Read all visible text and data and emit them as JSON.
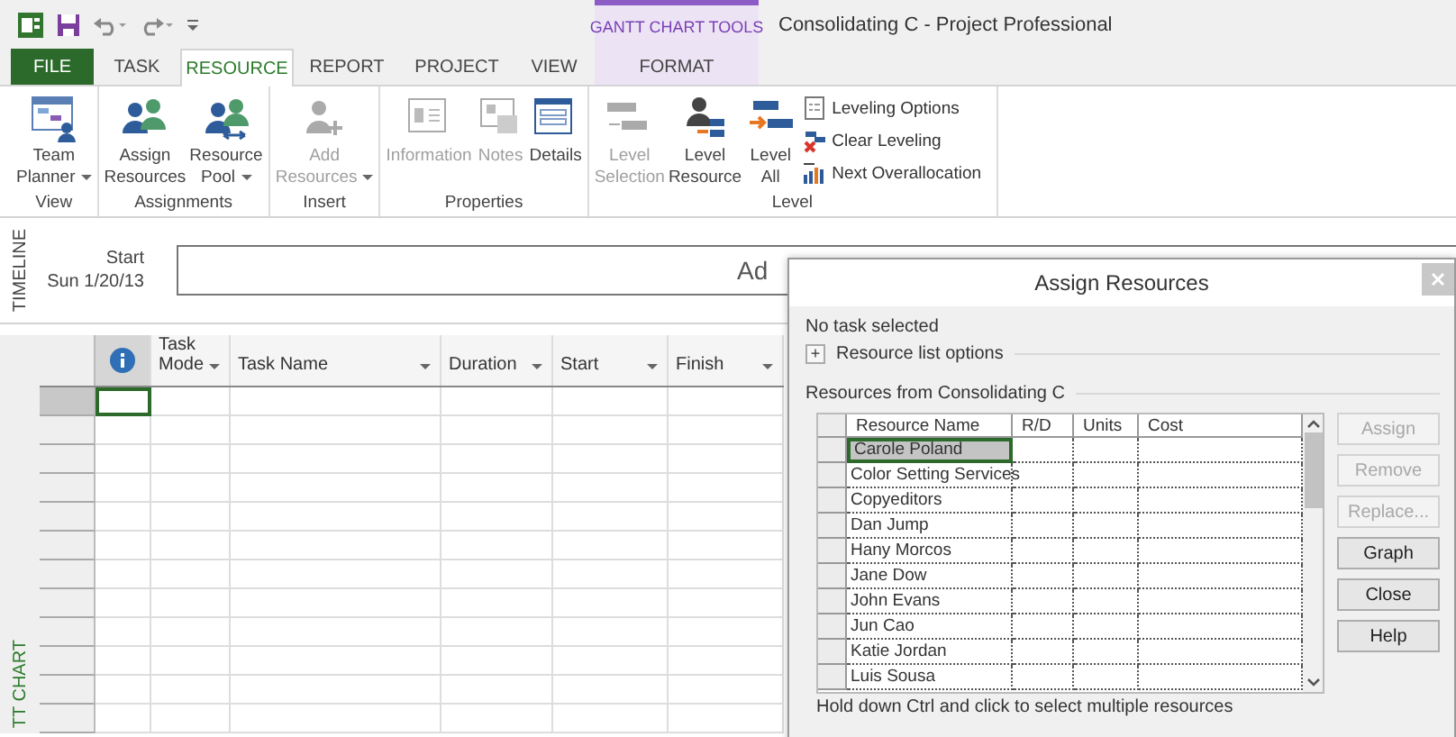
{
  "window": {
    "title": "Consolidating C - Project Professional"
  },
  "contextual_group": {
    "label": "GANTT CHART TOOLS"
  },
  "tabs": [
    {
      "label": "FILE",
      "kind": "file",
      "selected": false
    },
    {
      "label": "TASK",
      "kind": "normal",
      "selected": false
    },
    {
      "label": "RESOURCE",
      "kind": "normal",
      "selected": true
    },
    {
      "label": "REPORT",
      "kind": "normal",
      "selected": false
    },
    {
      "label": "PROJECT",
      "kind": "normal",
      "selected": false
    },
    {
      "label": "VIEW",
      "kind": "normal",
      "selected": false
    },
    {
      "label": "FORMAT",
      "kind": "contextual",
      "selected": false
    }
  ],
  "ribbon": {
    "groups": [
      {
        "label": "View",
        "commands": [
          {
            "kind": "large",
            "lines": [
              "Team",
              "Planner"
            ],
            "dropdown": true,
            "disabled": false
          }
        ]
      },
      {
        "label": "Assignments",
        "commands": [
          {
            "kind": "large",
            "lines": [
              "Assign",
              "Resources"
            ],
            "dropdown": false,
            "disabled": false
          },
          {
            "kind": "large",
            "lines": [
              "Resource",
              "Pool"
            ],
            "dropdown": true,
            "disabled": false
          }
        ]
      },
      {
        "label": "Insert",
        "commands": [
          {
            "kind": "large",
            "lines": [
              "Add",
              "Resources"
            ],
            "dropdown": true,
            "disabled": true
          }
        ]
      },
      {
        "label": "Properties",
        "commands": [
          {
            "kind": "large",
            "lines": [
              "Information"
            ],
            "dropdown": false,
            "disabled": true
          },
          {
            "kind": "large",
            "lines": [
              "Notes"
            ],
            "dropdown": false,
            "disabled": true
          },
          {
            "kind": "large",
            "lines": [
              "Details"
            ],
            "dropdown": false,
            "disabled": false
          }
        ]
      },
      {
        "label": "Level",
        "commands": [
          {
            "kind": "large",
            "lines": [
              "Level",
              "Selection"
            ],
            "dropdown": false,
            "disabled": true
          },
          {
            "kind": "large",
            "lines": [
              "Level",
              "Resource"
            ],
            "dropdown": false,
            "disabled": false
          },
          {
            "kind": "large",
            "lines": [
              "Level",
              "All"
            ],
            "dropdown": false,
            "disabled": false
          },
          {
            "kind": "small",
            "lines": [
              "Leveling Options"
            ],
            "disabled": false
          },
          {
            "kind": "small",
            "lines": [
              "Clear Leveling"
            ],
            "disabled": false
          },
          {
            "kind": "small",
            "lines": [
              "Next Overallocation"
            ],
            "disabled": false
          }
        ]
      }
    ]
  },
  "timeline": {
    "side_label": "TIMELINE",
    "start_label": "Start",
    "start_date": "Sun 1/20/13",
    "bar_text": "Ad"
  },
  "gantt": {
    "side_label": "TT CHART",
    "columns": [
      {
        "kind": "info",
        "dropdown": false
      },
      {
        "kind": "text",
        "label": "Task Mode",
        "dropdown": true
      },
      {
        "kind": "text",
        "label": "Task Name",
        "dropdown": true
      },
      {
        "kind": "text",
        "label": "Duration",
        "dropdown": true
      },
      {
        "kind": "text",
        "label": "Start",
        "dropdown": true
      },
      {
        "kind": "text",
        "label": "Finish",
        "dropdown": true
      }
    ]
  },
  "dialog": {
    "title": "Assign Resources",
    "status": "No task selected",
    "options_toggle": "+",
    "options_label": "Resource list options",
    "list_label": "Resources from Consolidating C",
    "columns": [
      "Resource Name",
      "R/D",
      "Units",
      "Cost"
    ],
    "rows": [
      {
        "name": "Carole Poland",
        "selected": true
      },
      {
        "name": "Color Setting Services",
        "selected": false
      },
      {
        "name": "Copyeditors",
        "selected": false
      },
      {
        "name": "Dan Jump",
        "selected": false
      },
      {
        "name": "Hany Morcos",
        "selected": false
      },
      {
        "name": "Jane Dow",
        "selected": false
      },
      {
        "name": "John Evans",
        "selected": false
      },
      {
        "name": "Jun Cao",
        "selected": false
      },
      {
        "name": "Katie Jordan",
        "selected": false
      },
      {
        "name": "Luis Sousa",
        "selected": false
      }
    ],
    "buttons": [
      {
        "label": "Assign",
        "disabled": true
      },
      {
        "label": "Remove",
        "disabled": true
      },
      {
        "label": "Replace...",
        "disabled": true
      },
      {
        "label": "Graph",
        "disabled": false
      },
      {
        "label": "Close",
        "disabled": false
      },
      {
        "label": "Help",
        "disabled": false
      }
    ],
    "hint": "Hold down Ctrl and click to select multiple resources"
  }
}
